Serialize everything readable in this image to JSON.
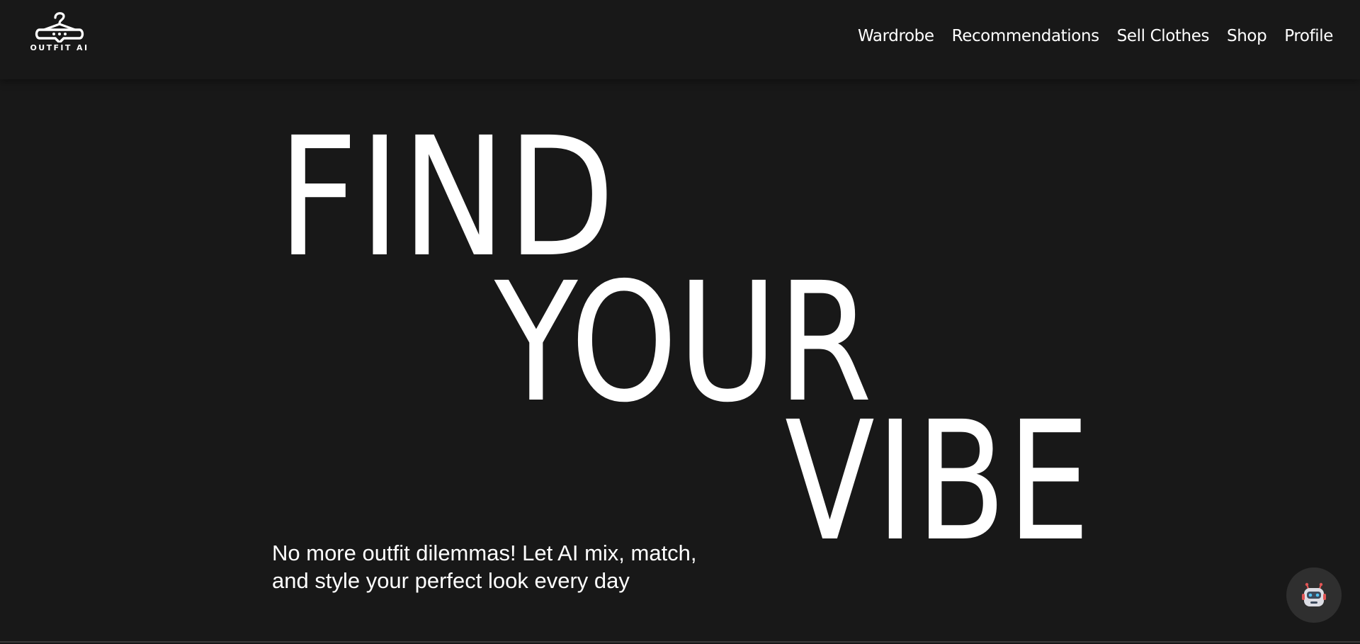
{
  "brand": {
    "name": "OUTFIT AI",
    "logo_icon": "hanger-speech-bubble-icon"
  },
  "nav": {
    "items": [
      {
        "label": "Wardrobe"
      },
      {
        "label": "Recommendations"
      },
      {
        "label": "Sell Clothes"
      },
      {
        "label": "Shop"
      },
      {
        "label": "Profile"
      }
    ]
  },
  "hero": {
    "words": [
      "FIND",
      "YOUR",
      "VIBE"
    ],
    "subtitle": "No more outfit dilemmas! Let AI mix, match, and style your perfect look every day"
  },
  "chatbot": {
    "icon": "robot-icon"
  },
  "colors": {
    "background": "#181818",
    "text": "#ffffff",
    "chat_button_bg": "#2f2f2f"
  }
}
